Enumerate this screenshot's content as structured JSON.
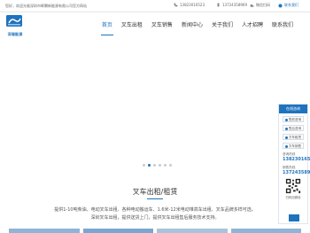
{
  "topbar": {
    "welcome": "您好，欢迎光临深圳市辉腾新能源有限公司官方网站",
    "phone_label": "13823016523",
    "mobile_label": "13724358969",
    "login_label": "联系我们",
    "register_label": "微信扫码"
  },
  "logo": {
    "brand": "SRM",
    "subtitle": "深瑞能源"
  },
  "nav": {
    "items": [
      "首页",
      "叉车出租",
      "叉车销售",
      "新闻中心",
      "关于我们",
      "人才招聘",
      "联系我们"
    ],
    "active": "首页"
  },
  "banner": {
    "slides": 6,
    "active_index": 1
  },
  "section": {
    "title": "叉车出租/租赁",
    "lines": [
      "提供1-10吨柴油、电动叉车出租、各种电动搬运车、1.6米-12米电动堆高车出租、叉车品牌多样可选。",
      "深圳叉车出租，提供送货上门，提供叉车出租售后服务技术支持。"
    ]
  },
  "side": {
    "title": "在线咨询",
    "buttons": [
      "售前咨询",
      "售后咨询",
      "叉车租赁",
      "叉车销售"
    ],
    "phone_label": "咨询热线",
    "phone": "13823016523",
    "mobile_label": "销售热线",
    "mobile": "13724358969",
    "qr_caption": "扫码加微信"
  },
  "colors": {
    "accent": "#1e73be"
  }
}
